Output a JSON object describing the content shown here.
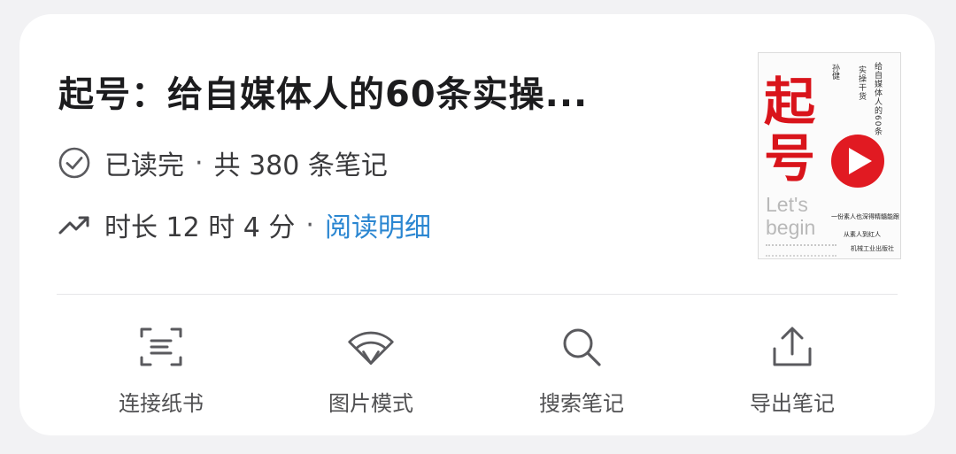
{
  "book": {
    "title": "起号：给自媒体人的60条实操...",
    "status": "已读完",
    "separator": "·",
    "notes_count": "共 380 条笔记",
    "duration": "时长 12 时 4 分",
    "detail_link": "阅读明细"
  },
  "cover": {
    "big_char_1": "起",
    "big_char_2": "号",
    "english_1": "Let's",
    "english_2": "begin",
    "vertical_title_1": "给自媒体人的60条",
    "vertical_title_2": "实操干货",
    "author": "孙健",
    "tagline_1": "一份素人也深得精髓能跟",
    "tagline_2": "从素人到红人",
    "publisher": "机械工业出版社",
    "accent_color": "#d9141b"
  },
  "actions": [
    {
      "label": "连接纸书",
      "icon": "scan-text-icon"
    },
    {
      "label": "图片模式",
      "icon": "fan-icon"
    },
    {
      "label": "搜索笔记",
      "icon": "search-icon"
    },
    {
      "label": "导出笔记",
      "icon": "export-icon"
    }
  ],
  "colors": {
    "link": "#2a86d1",
    "title": "#1c1c1e",
    "text": "#3a3a3c",
    "card": "#ffffff",
    "background": "#f2f2f4"
  }
}
